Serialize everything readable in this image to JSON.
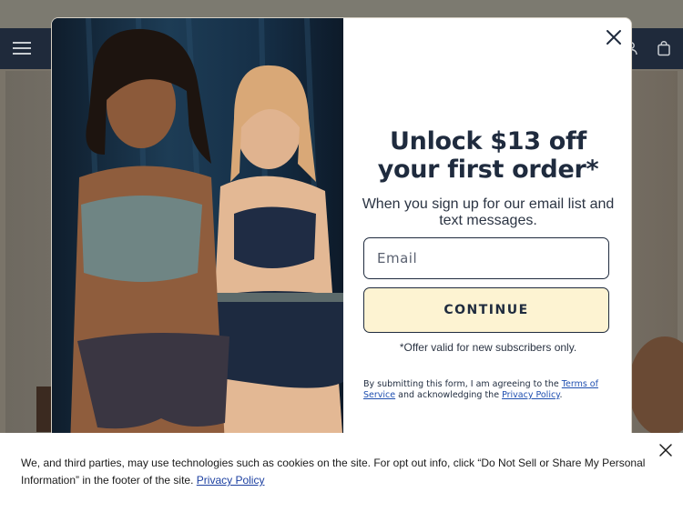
{
  "colors": {
    "navy": "#1f2b3e",
    "cta_background": "#fdf3d2",
    "link": "#1f4fb0",
    "cookie_link": "#1b3fa0",
    "header_background": "#1f2a3b"
  },
  "header": {
    "menu_icon": "hamburger-menu-icon",
    "account_icon": "user-icon",
    "bag_icon": "shopping-bag-icon"
  },
  "modal": {
    "image_alt": "Two women wearing bralettes and boyshorts",
    "close_icon": "close-icon",
    "title_line1": "Unlock $13 off",
    "title_line2": "your first order*",
    "subtitle": "When you sign up for our email list and text messages.",
    "email": {
      "placeholder": "Email",
      "value": ""
    },
    "continue_label": "CONTINUE",
    "offer_note": "*Offer valid for new subscribers only.",
    "legal": {
      "prefix": "By submitting this form, I am agreeing to the ",
      "terms_link": "Terms of Service",
      "middle": " and acknowledging the ",
      "privacy_link": "Privacy Policy",
      "suffix": "."
    }
  },
  "cookie_banner": {
    "text": "We, and third parties, may use technologies such as cookies on the site. For opt out info, click “Do Not Sell or Share My Personal Information” in the footer of the site. ",
    "privacy_link": "Privacy Policy",
    "close_icon": "close-icon"
  }
}
